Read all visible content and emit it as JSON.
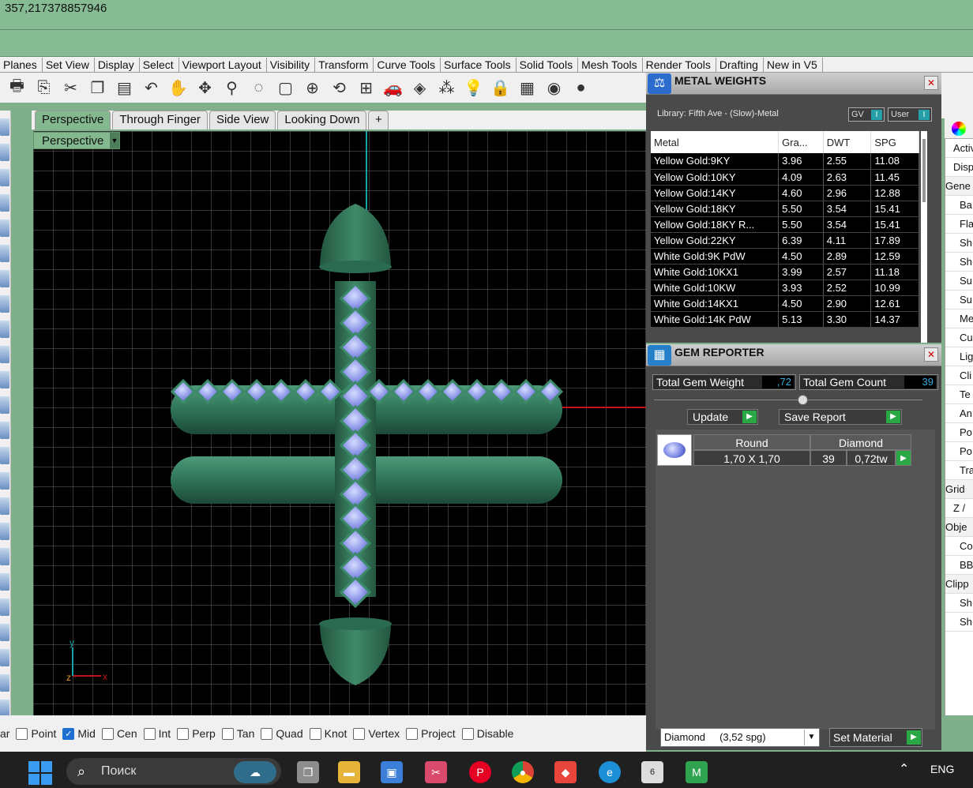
{
  "command": {
    "coords": "357,217378857946"
  },
  "tabs": [
    "Planes",
    "Set View",
    "Display",
    "Select",
    "Viewport Layout",
    "Visibility",
    "Transform",
    "Curve Tools",
    "Surface Tools",
    "Solid Tools",
    "Mesh Tools",
    "Render Tools",
    "Drafting",
    "New in V5"
  ],
  "toolbar_icons": [
    "print-icon",
    "copy-icon",
    "cut-icon",
    "paste-icon",
    "clipboard-icon",
    "undo-icon",
    "pan-hand-icon",
    "rotate-view-icon",
    "zoom-icon",
    "zoom-window-icon",
    "zoom-extents-icon",
    "zoom-selected-icon",
    "undo-view-icon",
    "four-viewports-icon",
    "car-icon",
    "render-preview-icon",
    "snap-grid-icon",
    "light-icon",
    "lock-icon",
    "layers-icon",
    "color-wheel-icon",
    "sphere-icon"
  ],
  "viewport_tabs": [
    "Perspective",
    "Through Finger",
    "Side View",
    "Looking Down"
  ],
  "viewport": {
    "label": "Perspective",
    "axis_x": "x",
    "axis_y": "y",
    "axis_z": "z"
  },
  "snaps": [
    {
      "label": "ar",
      "checked": null
    },
    {
      "label": "Point",
      "checked": false
    },
    {
      "label": "Mid",
      "checked": true
    },
    {
      "label": "Cen",
      "checked": false
    },
    {
      "label": "Int",
      "checked": false
    },
    {
      "label": "Perp",
      "checked": false
    },
    {
      "label": "Tan",
      "checked": false
    },
    {
      "label": "Quad",
      "checked": false
    },
    {
      "label": "Knot",
      "checked": false
    },
    {
      "label": "Vertex",
      "checked": false
    },
    {
      "label": "Project",
      "checked": false
    },
    {
      "label": "Disable",
      "checked": false
    }
  ],
  "metal_weights": {
    "title": "METAL WEIGHTS",
    "library": "Library: Fifth Ave - (Slow)-Metal",
    "toggle_gv": "GV",
    "toggle_user": "User",
    "columns": [
      "Metal",
      "Gra...",
      "DWT",
      "SPG"
    ],
    "rows": [
      [
        "Yellow Gold:9KY",
        "3.96",
        "2.55",
        "11.08"
      ],
      [
        "Yellow Gold:10KY",
        "4.09",
        "2.63",
        "11.45"
      ],
      [
        "Yellow Gold:14KY",
        "4.60",
        "2.96",
        "12.88"
      ],
      [
        "Yellow Gold:18KY",
        "5.50",
        "3.54",
        "15.41"
      ],
      [
        "Yellow Gold:18KY R...",
        "5.50",
        "3.54",
        "15.41"
      ],
      [
        "Yellow Gold:22KY",
        "6.39",
        "4.11",
        "17.89"
      ],
      [
        "White Gold:9K PdW",
        "4.50",
        "2.89",
        "12.59"
      ],
      [
        "White Gold:10KX1",
        "3.99",
        "2.57",
        "11.18"
      ],
      [
        "White Gold:10KW",
        "3.93",
        "2.52",
        "10.99"
      ],
      [
        "White Gold:14KX1",
        "4.50",
        "2.90",
        "12.61"
      ],
      [
        "White Gold:14K PdW",
        "5.13",
        "3.30",
        "14.37"
      ]
    ]
  },
  "gem_reporter": {
    "title": "GEM REPORTER",
    "total_weight_label": "Total Gem Weight",
    "total_weight_value": ",72",
    "total_count_label": "Total Gem Count",
    "total_count_value": "39",
    "update_label": "Update",
    "save_report_label": "Save Report",
    "gem": {
      "cut": "Round",
      "material": "Diamond",
      "size": "1,70 X 1,70",
      "count": "39",
      "carat": "0,72tw"
    },
    "material_select": "Diamond     (3,52 spg)",
    "set_material_label": "Set Material"
  },
  "properties": [
    "Activ",
    "Displ",
    "Gene",
    "Ba",
    "Fla",
    "Sh",
    "Sh",
    "Su",
    "Su",
    "Me",
    "Cu",
    "Lig",
    "Cli",
    "Te",
    "An",
    "Po",
    "Po",
    "Tra",
    "Grid",
    "Z /",
    "Obje",
    "Co",
    "BB",
    "Clipp",
    "Sh",
    "Sh"
  ],
  "taskbar": {
    "search_placeholder": "Поиск",
    "lang": "ENG",
    "badge": "6"
  }
}
